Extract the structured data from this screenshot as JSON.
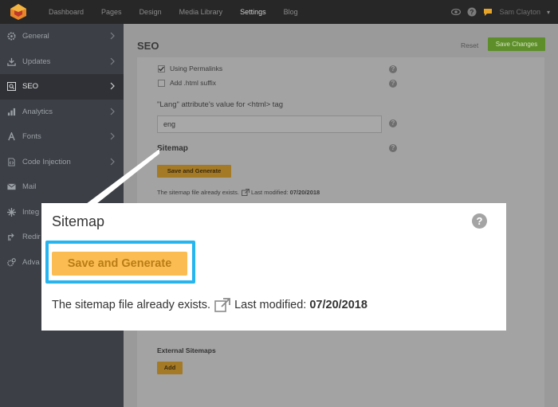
{
  "topbar": {
    "nav": [
      "Dashboard",
      "Pages",
      "Design",
      "Media Library",
      "Settings",
      "Blog"
    ],
    "active": "Settings",
    "user": "Sam Clayton"
  },
  "sidebar": {
    "items": [
      {
        "label": "General",
        "icon": "gear-icon"
      },
      {
        "label": "Updates",
        "icon": "download-icon"
      },
      {
        "label": "SEO",
        "icon": "search-icon",
        "active": true
      },
      {
        "label": "Analytics",
        "icon": "bar-chart-icon"
      },
      {
        "label": "Fonts",
        "icon": "font-icon"
      },
      {
        "label": "Code Injection",
        "icon": "code-file-icon"
      },
      {
        "label": "Mail",
        "icon": "mail-icon"
      },
      {
        "label": "Integ",
        "icon": "puzzle-icon"
      },
      {
        "label": "Redir",
        "icon": "redirect-icon"
      },
      {
        "label": "Adva",
        "icon": "advanced-gear-icon"
      }
    ]
  },
  "main": {
    "title": "SEO",
    "reset": "Reset",
    "save": "Save Changes",
    "using_permalinks": "Using Permalinks",
    "using_permalinks_checked": true,
    "html_suffix": "Add .html suffix",
    "html_suffix_checked": false,
    "lang_label": "\"Lang\" attribute's value for <html> tag",
    "lang_value": "eng",
    "sitemap_title": "Sitemap",
    "sitemap_button": "Save and Generate",
    "sitemap_status": "The sitemap file already exists.",
    "last_modified_label": "Last modified:",
    "last_modified_value": "07/20/2018",
    "external_title": "External Sitemaps",
    "add_button": "Add"
  },
  "callout": {
    "title": "Sitemap",
    "button": "Save and Generate",
    "status": "The sitemap file already exists.",
    "last_modified_label": "Last modified:",
    "last_modified_value": "07/20/2018"
  },
  "colors": {
    "accent": "#27b5ef",
    "button": "#fbbd52",
    "save": "#5d8e2a"
  }
}
